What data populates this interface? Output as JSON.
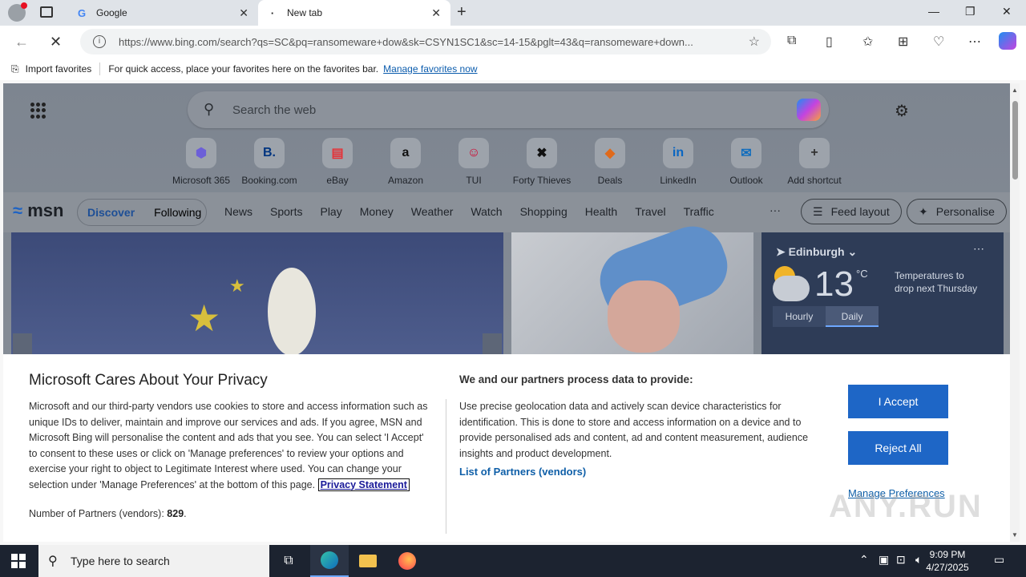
{
  "browser": {
    "tabs": [
      {
        "title": "Google",
        "favicon": "G"
      },
      {
        "title": "New tab",
        "favicon": "·"
      }
    ],
    "url": "https://www.bing.com/search?qs=SC&pq=ransomeware+dow&sk=CSYN1SC1&sc=14-15&pglt=43&q=ransomeware+down...",
    "favorites_bar": {
      "import_label": "Import favorites",
      "message": "For quick access, place your favorites here on the favorites bar.",
      "manage_link": "Manage favorites now"
    }
  },
  "newtab": {
    "search_placeholder": "Search the web",
    "shortcuts": [
      {
        "label": "Microsoft 365",
        "icon": "microsoft-365-icon",
        "glyph": "⬢",
        "color": "#6c5fd8"
      },
      {
        "label": "Booking.com",
        "icon": "booking-icon",
        "glyph": "B.",
        "color": "#003580"
      },
      {
        "label": "eBay",
        "icon": "ebay-icon",
        "glyph": "▤",
        "color": "#e53238"
      },
      {
        "label": "Amazon",
        "icon": "amazon-icon",
        "glyph": "a",
        "color": "#111111"
      },
      {
        "label": "TUI",
        "icon": "tui-icon",
        "glyph": "☺",
        "color": "#d2002d"
      },
      {
        "label": "Forty Thieves",
        "icon": "forty-thieves-icon",
        "glyph": "✖",
        "color": "#111111"
      },
      {
        "label": "Deals",
        "icon": "deals-icon",
        "glyph": "◆",
        "color": "#e06a1b"
      },
      {
        "label": "LinkedIn",
        "icon": "linkedin-icon",
        "glyph": "in",
        "color": "#0a66c2"
      },
      {
        "label": "Outlook",
        "icon": "outlook-icon",
        "glyph": "✉",
        "color": "#0f6cbd"
      },
      {
        "label": "Add shortcut",
        "icon": "plus-icon",
        "glyph": "+",
        "color": "#333333"
      }
    ],
    "msn": {
      "logo": "msn",
      "tabs": [
        "Discover",
        "Following"
      ],
      "nav": [
        "News",
        "Sports",
        "Play",
        "Money",
        "Weather",
        "Watch",
        "Shopping",
        "Health",
        "Travel",
        "Traffic"
      ],
      "more": "···",
      "feed_layout": "Feed layout",
      "personalise": "Personalise"
    },
    "weather": {
      "location": "Edinburgh",
      "temperature": "13",
      "unit": "°C",
      "note": "Temperatures to drop next Thursday",
      "tabs": [
        "Hourly",
        "Daily"
      ]
    }
  },
  "privacy": {
    "title": "Microsoft Cares About Your Privacy",
    "body": "Microsoft and our third-party vendors use cookies to store and access information such as unique IDs to deliver, maintain and improve our services and ads. If you agree, MSN and Microsoft Bing will personalise the content and ads that you see. You can select 'I Accept' to consent to these uses or click on 'Manage preferences' to review your options and exercise your right to object to Legitimate Interest where used.  You can change your selection under 'Manage Preferences' at the bottom of this page.",
    "privacy_link": "Privacy Statement",
    "partners_label": "Number of Partners (vendors):",
    "partners_count": "829",
    "right_title": "We and our partners process data to provide:",
    "right_body": "Use precise geolocation data and actively scan device characteristics for identification. This is done to store and access information on a device and to provide personalised ads and content, ad and content measurement, audience insights and product development.",
    "list_link": "List of Partners (vendors)",
    "accept": "I Accept",
    "reject": "Reject All",
    "manage": "Manage Preferences"
  },
  "watermark": "ANY.RUN",
  "taskbar": {
    "search_placeholder": "Type here to search",
    "time": "9:09 PM",
    "date": "4/27/2025"
  }
}
